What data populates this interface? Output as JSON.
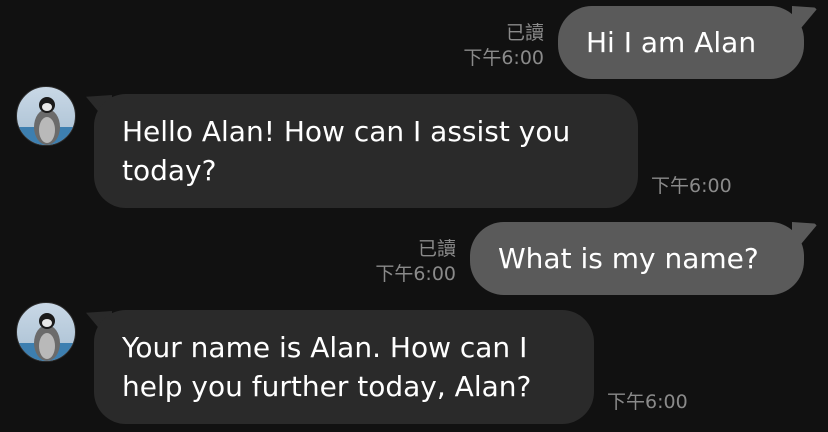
{
  "messages": [
    {
      "side": "out",
      "text": "Hi I am Alan",
      "read": "已讀",
      "time": "下午6:00"
    },
    {
      "side": "in",
      "text_lines": [
        "Hello Alan! How can I assist you",
        "today?"
      ],
      "time": "下午6:00",
      "avatar_icon": "penguin-avatar-icon"
    },
    {
      "side": "out",
      "text": "What is my name?",
      "read": "已讀",
      "time": "下午6:00"
    },
    {
      "side": "in",
      "text_lines": [
        "Your name is Alan. How can I",
        "help you further today, Alan?"
      ],
      "time": "下午6:00",
      "avatar_icon": "penguin-avatar-icon"
    }
  ],
  "colors": {
    "background": "#111111",
    "outgoing_bubble": "#5a5a5a",
    "incoming_bubble": "#2a2a2a",
    "meta_text": "#8a8a8a"
  }
}
